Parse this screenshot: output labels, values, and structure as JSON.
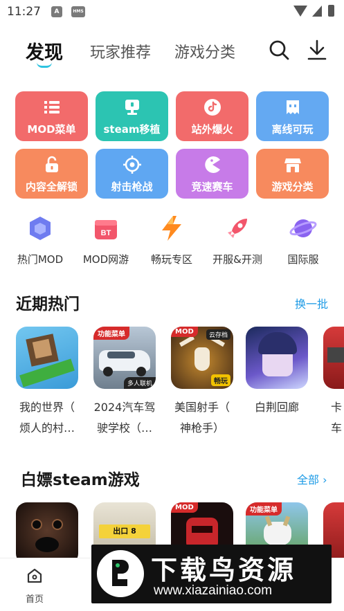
{
  "status_bar": {
    "time": "11:27",
    "icon_a": "A",
    "icon_hms": "HMS"
  },
  "topnav": {
    "tabs": [
      {
        "label": "发现",
        "active": true
      },
      {
        "label": "玩家推荐",
        "active": false
      },
      {
        "label": "游戏分类",
        "active": false
      }
    ],
    "icons": [
      "search-icon",
      "download-icon"
    ],
    "accent": "#2ec3e0"
  },
  "category_tiles": [
    {
      "label": "MOD菜单",
      "icon": "list-icon",
      "color": "#f26b6b"
    },
    {
      "label": "steam移植",
      "icon": "monitor-icon",
      "color": "#2cc4b2"
    },
    {
      "label": "站外爆火",
      "icon": "tiktok-icon",
      "color": "#f26b6b"
    },
    {
      "label": "离线可玩",
      "icon": "ghost-icon",
      "color": "#64a9f2"
    },
    {
      "label": "内容全解锁",
      "icon": "unlock-icon",
      "color": "#f78a5e"
    },
    {
      "label": "射击枪战",
      "icon": "crosshair-icon",
      "color": "#5fa7f2"
    },
    {
      "label": "竞速赛车",
      "icon": "pacman-icon",
      "color": "#c77be8"
    },
    {
      "label": "游戏分类",
      "icon": "store-icon",
      "color": "#f78a5e"
    }
  ],
  "shortcuts": [
    {
      "label": "热门MOD",
      "icon": "cube-icon"
    },
    {
      "label": "MOD网游",
      "icon": "bt-gift-icon"
    },
    {
      "label": "畅玩专区",
      "icon": "lightning-icon"
    },
    {
      "label": "开服&开测",
      "icon": "rocket-icon"
    },
    {
      "label": "国际服",
      "icon": "planet-icon"
    }
  ],
  "section_recent": {
    "title": "近期热门",
    "action": "换一批",
    "games": [
      {
        "name_line1": "我的世界（",
        "name_line2": "烦人的村…",
        "cover": "minecraft-cover",
        "badge_tl": "",
        "badge_br": "",
        "badge_tr": "",
        "badge_yb": ""
      },
      {
        "name_line1": "2024汽车驾",
        "name_line2": "驶学校（…",
        "cover": "car-cover",
        "badge_tl": "功能菜单",
        "badge_br": "多人联机",
        "badge_tr": "",
        "badge_yb": ""
      },
      {
        "name_line1": "美国射手（",
        "name_line2": "神枪手）",
        "cover": "deer-skull-cover",
        "badge_tl": "MOD",
        "badge_br": "",
        "badge_tr": "云存档",
        "badge_yb": "畅玩"
      },
      {
        "name_line1": "白荆回廊",
        "name_line2": "",
        "cover": "anime-girl-cover",
        "badge_tl": "",
        "badge_br": "",
        "badge_tr": "",
        "badge_yb": ""
      },
      {
        "name_line1": "卡车",
        "name_line2": "",
        "cover": "truck-cover",
        "badge_tl": "",
        "badge_br": "",
        "badge_tr": "",
        "badge_yb": ""
      }
    ]
  },
  "section_steam": {
    "title": "白嫖steam游戏",
    "action": "全部",
    "games": [
      {
        "cover": "horror-face-cover",
        "badge_tl": ""
      },
      {
        "cover": "exit-8-cover",
        "badge_tl": "",
        "sign_text": "出口 8"
      },
      {
        "cover": "red-robot-cover",
        "badge_tl": "MOD"
      },
      {
        "cover": "goat-cover",
        "badge_tl": "功能菜单"
      },
      {
        "cover": "truck-cover",
        "badge_tl": ""
      }
    ]
  },
  "bottom_nav": [
    {
      "label": "首页",
      "icon": "home-icon"
    }
  ],
  "watermark": {
    "title": "下载鸟资源",
    "url": "www.xiazainiao.com"
  }
}
